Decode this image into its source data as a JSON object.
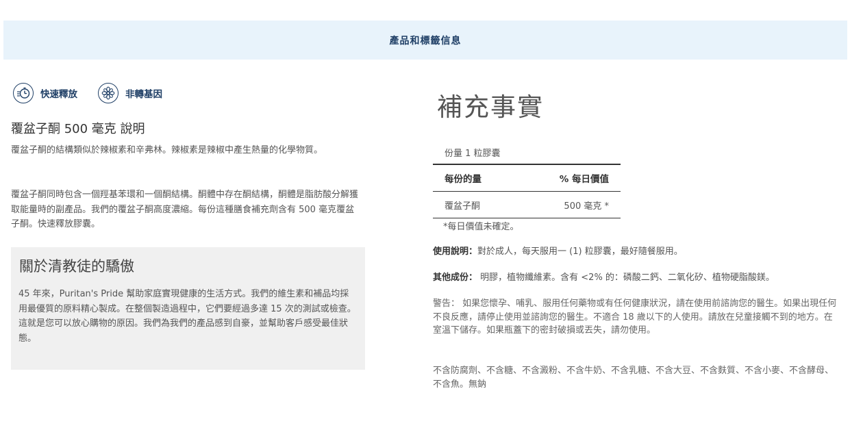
{
  "banner": {
    "title": "產品和標籤信息"
  },
  "badges": [
    {
      "icon": "quick-release-icon",
      "label": "快速釋放"
    },
    {
      "icon": "non-gmo-flower-icon",
      "label": "非轉基因"
    }
  ],
  "description": {
    "title": "覆盆子酮 500 毫克 說明",
    "para1": "覆盆子酮的結構類似於辣椒素和辛弗林。辣椒素是辣椒中產生熱量的化學物質。",
    "para2": "覆盆子酮同時包含一個羥基苯環和一個酮結構。酮體中存在酮結構，酮體是脂肪酸分解獲取能量時的副產品。我們的覆盆子酮高度濃縮。每份這種膳食補充劑含有 500 毫克覆盆子酮。快速釋放膠囊。"
  },
  "pride": {
    "title": "關於清教徒的驕傲",
    "text": "45 年來，Puritan's Pride 幫助家庭實現健康的生活方式。我們的維生素和補品均採用最優質的原料精心製成。在整個製造過程中，它們要經過多達 15 次的測試或檢查。這就是您可以放心購物的原因。我們為我們的產品感到自豪，並幫助客戶感受最佳狀態。"
  },
  "supplement_facts": {
    "title": "補充事實",
    "serving": "份量 1 粒膠囊",
    "col1": "每份的量",
    "col2": "% 每日價值",
    "row_name": "覆盆子酮",
    "row_value": "500 毫克 *",
    "note": "*每日價值未確定。"
  },
  "usage": {
    "label": "使用說明：",
    "text": "對於成人，每天服用一 (1) 粒膠囊，最好隨餐服用。"
  },
  "other": {
    "label": "其他成份：",
    "text": " 明膠，植物纖維素。含有 <2% 的：磷酸二鈣、二氧化矽、植物硬脂酸鎂。"
  },
  "warning": "警告： 如果您懷孕、哺乳、服用任何藥物或有任何健康狀況，請在使用前諮詢您的醫生。如果出現任何不良反應，請停止使用並諮詢您的醫生。不適合 18 歲以下的人使用。請放在兒童接觸不到的地方。在室溫下儲存。如果瓶蓋下的密封破損或丟失，請勿使用。",
  "free_from": "不含防腐劑、不含糖、不含澱粉、不含牛奶、不含乳糖、不含大豆、不含麩質、不含小麥、不含酵母、不含魚。無鈉",
  "colors": {
    "accent": "#1f3f66",
    "banner_bg": "#e8f3fb",
    "box_bg": "#f0f0f0"
  }
}
